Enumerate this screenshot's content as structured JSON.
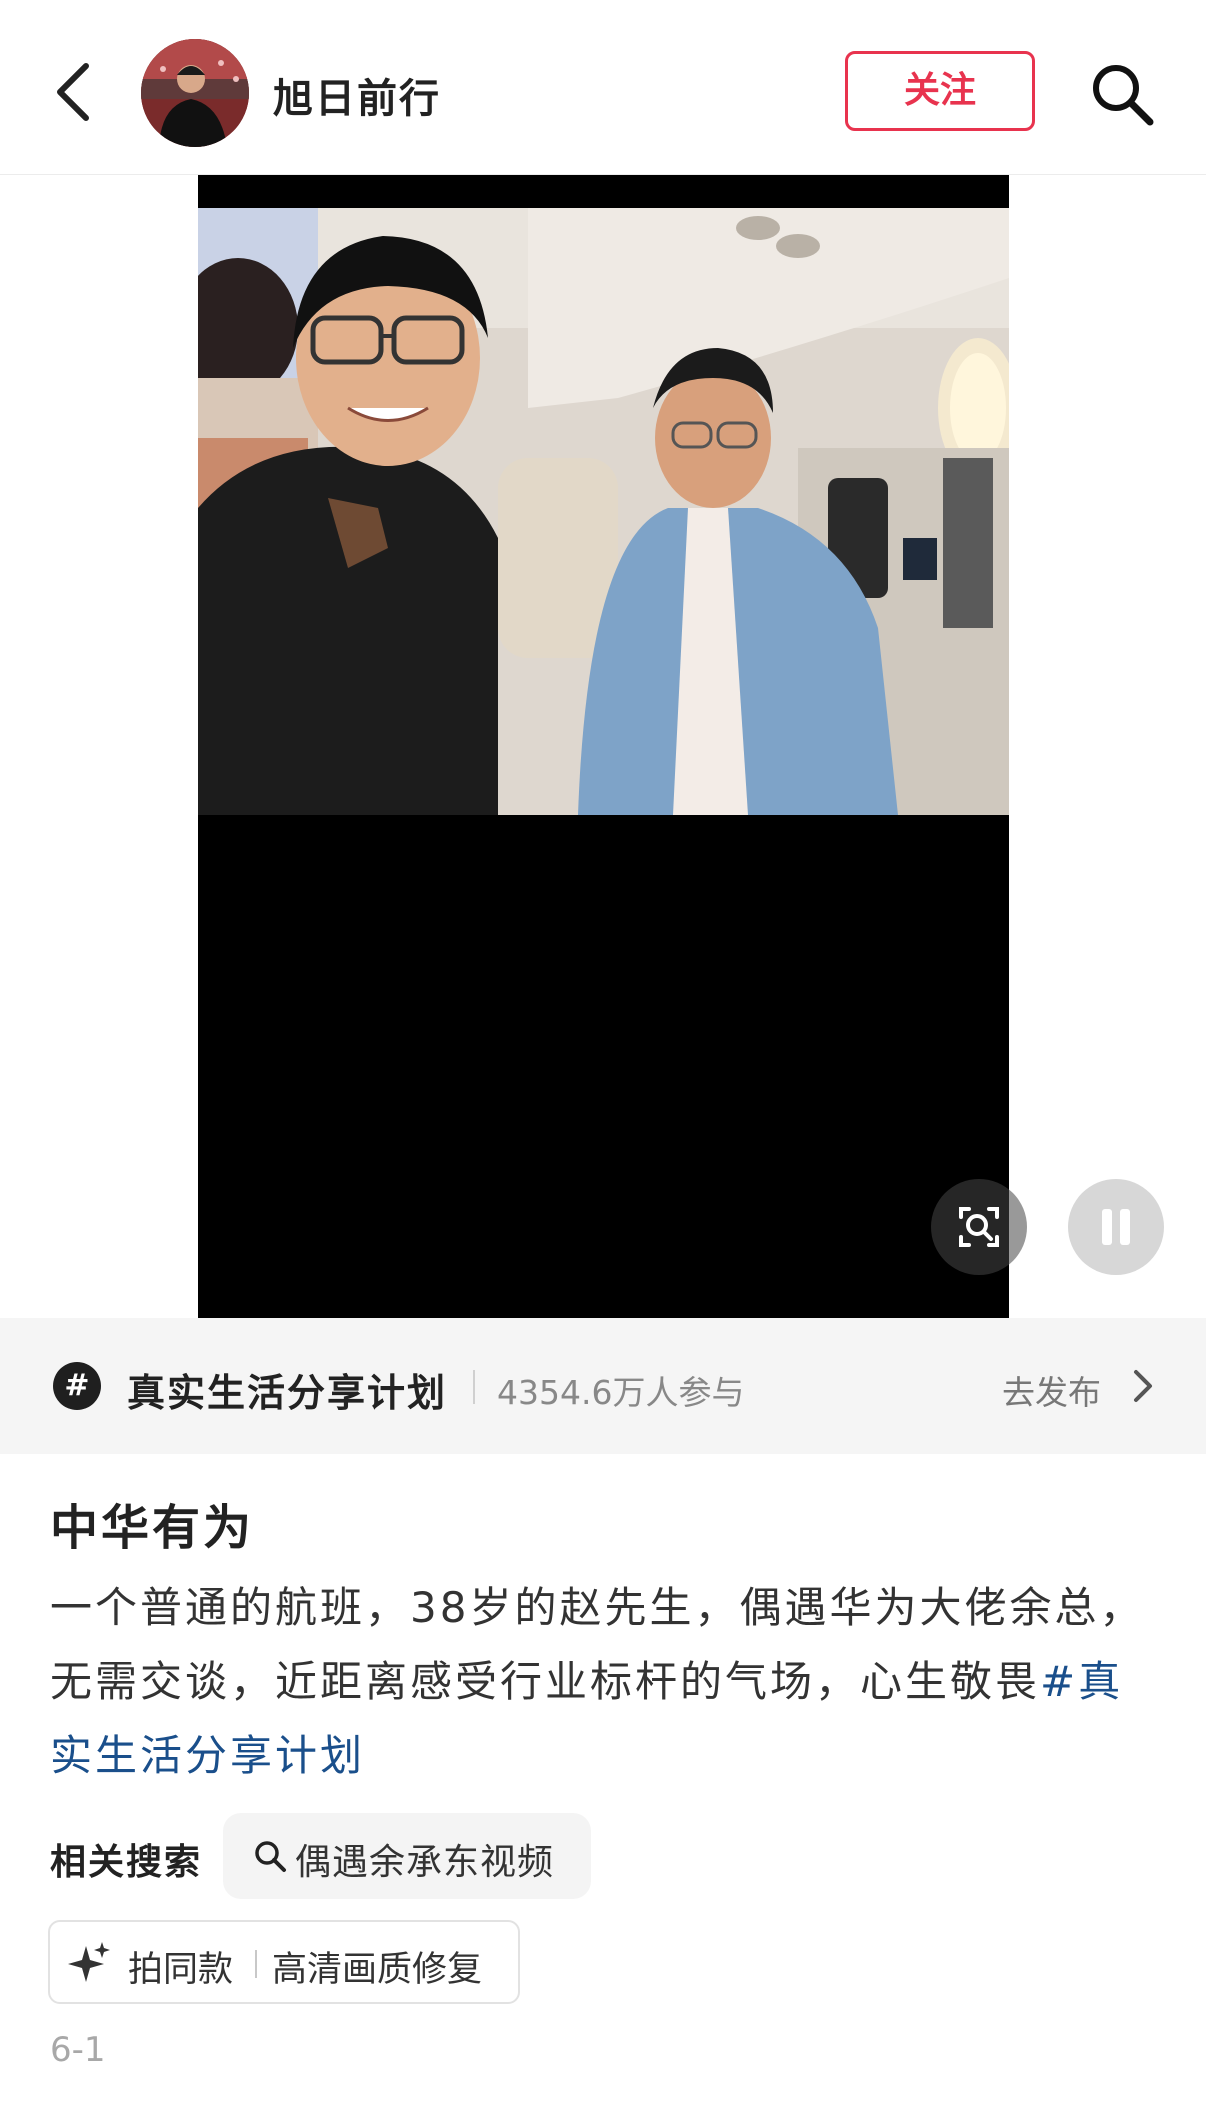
{
  "header": {
    "username": "旭日前行",
    "follow_label": "关注"
  },
  "topic": {
    "symbol": "#",
    "title": "真实生活分享计划",
    "participants": "4354.6万人参与",
    "publish_label": "去发布"
  },
  "post": {
    "title": "中华有为",
    "body": "一个普通的航班，38岁的赵先生，偶遇华为大佬余总，无需交谈，近距离感受行业标杆的气场，心生敬畏",
    "hashtag": "#真实生活分享计划",
    "date": "6-1"
  },
  "related": {
    "label": "相关搜索",
    "query": "偶遇余承东视频"
  },
  "effect": {
    "action": "拍同款",
    "name": "高清画质修复"
  },
  "colors": {
    "accent": "#e8334e",
    "hashtag": "#1a4f8b",
    "topic_bar_bg": "#f5f5f5"
  },
  "icons": [
    "back-arrow-icon",
    "search-icon",
    "hashtag-icon",
    "chevron-right-icon",
    "lens-search-icon",
    "pause-icon",
    "sparkle-icon"
  ]
}
